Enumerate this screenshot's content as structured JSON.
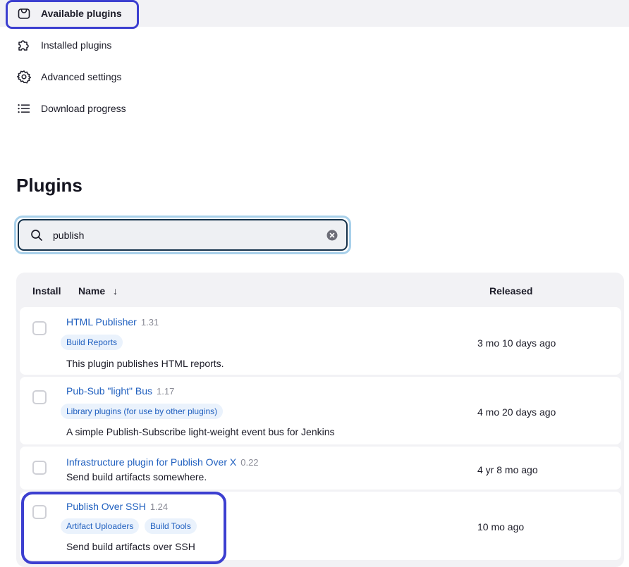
{
  "nav": {
    "items": [
      {
        "label": "Available plugins",
        "icon": "shopping-bag-icon",
        "active": true
      },
      {
        "label": "Installed plugins",
        "icon": "puzzle-icon"
      },
      {
        "label": "Advanced settings",
        "icon": "gear-icon"
      },
      {
        "label": "Download progress",
        "icon": "list-icon"
      }
    ]
  },
  "page": {
    "title": "Plugins"
  },
  "search": {
    "value": "publish",
    "clear_icon": "clear-icon"
  },
  "table": {
    "headers": {
      "install": "Install",
      "name": "Name",
      "sort_arrow": "↓",
      "released": "Released"
    },
    "rows": [
      {
        "name": "HTML Publisher",
        "version": "1.31",
        "tags": [
          "Build Reports"
        ],
        "description": "This plugin publishes HTML reports.",
        "released": "3 mo 10 days ago"
      },
      {
        "name": "Pub-Sub \"light\" Bus",
        "version": "1.17",
        "tags": [
          "Library plugins (for use by other plugins)"
        ],
        "description": "A simple Publish-Subscribe light-weight event bus for Jenkins",
        "released": "4 mo 20 days ago"
      },
      {
        "name": "Infrastructure plugin for Publish Over X",
        "version": "0.22",
        "tags": [],
        "description": "Send build artifacts somewhere.",
        "released": "4 yr 8 mo ago"
      },
      {
        "name": "Publish Over SSH",
        "version": "1.24",
        "tags": [
          "Artifact Uploaders",
          "Build Tools"
        ],
        "description": "Send build artifacts over SSH",
        "released": "10 mo ago"
      }
    ]
  },
  "colors": {
    "link": "#1f5fbf",
    "highlight": "#3c3fd0",
    "tag_bg": "#eaf2fc"
  }
}
